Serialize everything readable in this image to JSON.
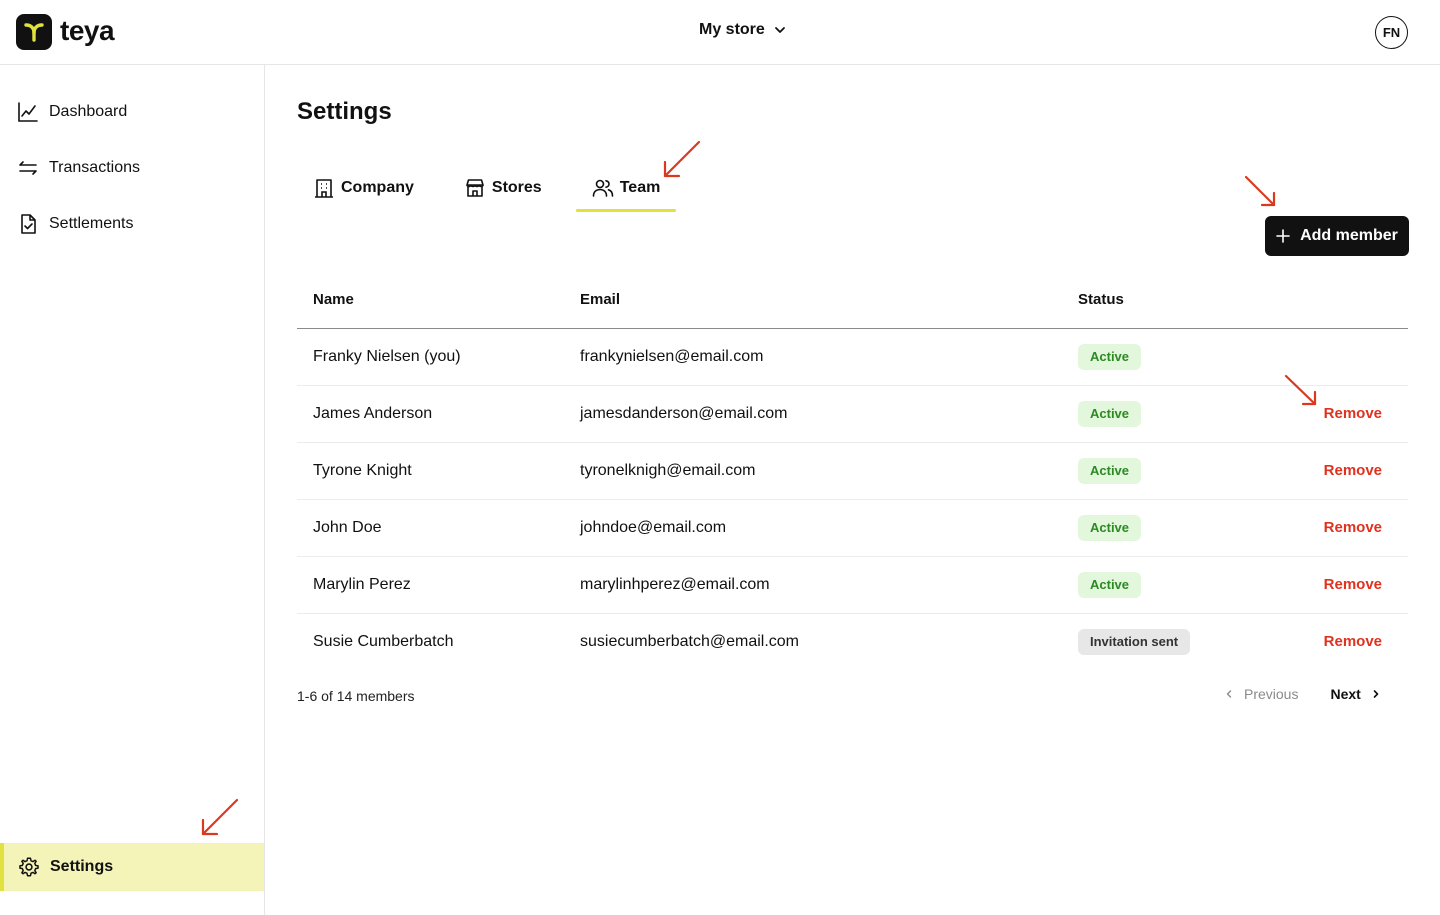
{
  "header": {
    "logo_text": "teya",
    "store_label": "My store",
    "avatar_initials": "FN"
  },
  "sidebar": {
    "items": [
      {
        "label": "Dashboard",
        "icon": "chart-line-icon"
      },
      {
        "label": "Transactions",
        "icon": "arrows-exchange-icon"
      },
      {
        "label": "Settlements",
        "icon": "document-check-icon"
      }
    ],
    "settings": {
      "label": "Settings",
      "icon": "gear-icon",
      "active": true
    }
  },
  "main": {
    "title": "Settings",
    "tabs": [
      {
        "label": "Company",
        "icon": "building-icon",
        "active": false
      },
      {
        "label": "Stores",
        "icon": "store-icon",
        "active": false
      },
      {
        "label": "Team",
        "icon": "users-icon",
        "active": true
      }
    ],
    "add_button_label": "Add member",
    "table": {
      "columns": [
        "Name",
        "Email",
        "Status"
      ],
      "rows": [
        {
          "name": "Franky Nielsen (you)",
          "email": "frankynielsen@email.com",
          "status": "Active",
          "action": ""
        },
        {
          "name": "James Anderson",
          "email": "jamesdanderson@email.com",
          "status": "Active",
          "action": "Remove"
        },
        {
          "name": "Tyrone Knight",
          "email": "tyronelknigh@email.com",
          "status": "Active",
          "action": "Remove"
        },
        {
          "name": "John Doe",
          "email": "johndoe@email.com",
          "status": "Active",
          "action": "Remove"
        },
        {
          "name": "Marylin Perez",
          "email": "marylinhperez@email.com",
          "status": "Active",
          "action": "Remove"
        },
        {
          "name": "Susie Cumberbatch",
          "email": "susiecumberbatch@email.com",
          "status": "Invitation sent",
          "action": "Remove"
        }
      ]
    },
    "count_text": "1-6 of 14 members",
    "pagination": {
      "previous": "Previous",
      "next": "Next"
    }
  },
  "colors": {
    "accent_yellow": "#dfe23f",
    "active_nav_bg": "#f4f4b9",
    "remove_red": "#e0321f",
    "annotation_arrow": "#d93a1f",
    "active_badge_bg": "#e3f7dc",
    "active_badge_text": "#2c8a23"
  }
}
